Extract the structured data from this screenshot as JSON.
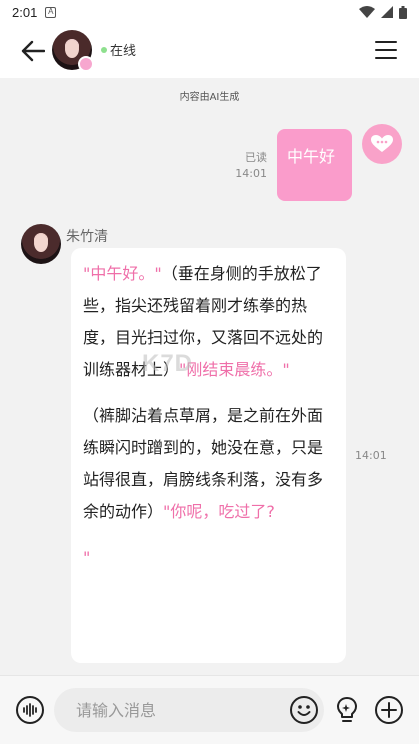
{
  "status_bar": {
    "time": "2:01",
    "a_icon_text": "A"
  },
  "header": {
    "status_text": "在线"
  },
  "notice": "内容由AI生成",
  "outgoing": {
    "read_label": "已读",
    "time": "14:01",
    "text": "中午好"
  },
  "incoming": {
    "sender": "朱竹清",
    "time": "14:01",
    "segments": [
      {
        "text": "\"中午好。\"",
        "pink": true
      },
      {
        "text": "（垂在身侧的手放松了些，指尖还残留着刚才练拳的热度，目光扫过你，又落回不远处的训练器材上）",
        "pink": false
      },
      {
        "text": "\"刚结束晨练。\"",
        "pink": true
      }
    ],
    "segments2": [
      {
        "text": "（裤脚沾着点草屑，是之前在外面练瞬闪时蹭到的，她没在意，只是站得很直，肩膀线条利落，没有多余的动作）",
        "pink": false
      },
      {
        "text": "\"你呢，吃过了?",
        "pink": true
      }
    ],
    "trailing_quote": "\""
  },
  "watermark": "K7D",
  "input": {
    "placeholder": "请输入消息"
  },
  "icons": {
    "back": "arrow-left-icon",
    "menu": "menu-icon",
    "voice": "voice-wave-icon",
    "emoji": "smiley-icon",
    "hint": "lightbulb-icon",
    "plus": "plus-icon"
  },
  "colors": {
    "accent_pink": "#fa9ccb",
    "pink_text": "#ef6fa9",
    "online_green": "#8ee08e"
  }
}
